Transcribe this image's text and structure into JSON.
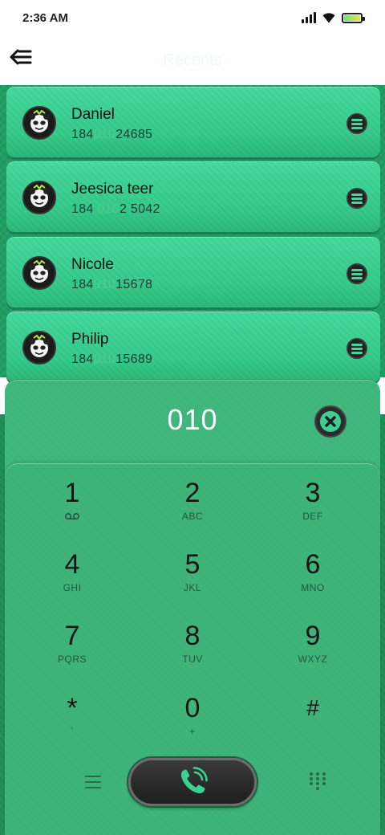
{
  "status_bar": {
    "time": "2:36 AM"
  },
  "header": {
    "title": "Recents"
  },
  "contacts": [
    {
      "name": "Daniel",
      "number_pre": "184",
      "number_match": "010",
      "number_post": "24685"
    },
    {
      "name": "Jeesica teer",
      "number_pre": "184 ",
      "number_match": "010",
      "number_post": "2 5042"
    },
    {
      "name": "Nicole",
      "number_pre": "184",
      "number_match": "010",
      "number_post": "15678"
    },
    {
      "name": "Philip",
      "number_pre": "184",
      "number_match": "010",
      "number_post": "15689"
    }
  ],
  "dialer": {
    "entered_number": "010",
    "keys": [
      {
        "digit": "1",
        "letters": "voicemail-icon"
      },
      {
        "digit": "2",
        "letters": "ABC"
      },
      {
        "digit": "3",
        "letters": "DEF"
      },
      {
        "digit": "4",
        "letters": "GHI"
      },
      {
        "digit": "5",
        "letters": "JKL"
      },
      {
        "digit": "6",
        "letters": "MNO"
      },
      {
        "digit": "7",
        "letters": "PQRS"
      },
      {
        "digit": "8",
        "letters": "TUV"
      },
      {
        "digit": "9",
        "letters": "WXYZ"
      },
      {
        "digit": "*",
        "letters": ","
      },
      {
        "digit": "0",
        "letters": "+"
      },
      {
        "digit": "#",
        "letters": ""
      }
    ]
  },
  "colors": {
    "card_green": "#3ecf92",
    "panel_green": "#3fb77d",
    "background_green": "#1f9c62",
    "match_highlight": "#55c98f"
  },
  "icons": {
    "back": "back-arrow-icon",
    "menu": "menu-icon",
    "clear": "clear-icon",
    "call": "phone-call-icon",
    "dialpad": "dialpad-icon",
    "avatar": "panda-avatar-icon"
  }
}
